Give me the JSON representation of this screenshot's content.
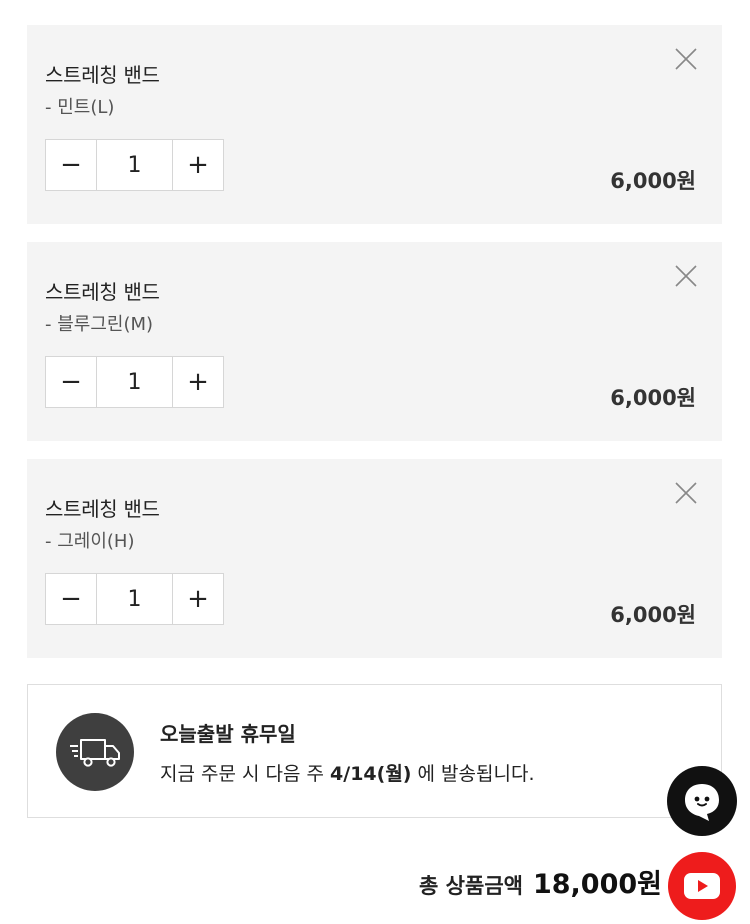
{
  "cart_items": [
    {
      "title": "스트레칭 밴드",
      "option": "- 민트(L)",
      "quantity": "1",
      "price": "6,000원"
    },
    {
      "title": "스트레칭 밴드",
      "option": "- 블루그린(M)",
      "quantity": "1",
      "price": "6,000원"
    },
    {
      "title": "스트레칭 밴드",
      "option": "- 그레이(H)",
      "quantity": "1",
      "price": "6,000원"
    }
  ],
  "stepper": {
    "minus": "−",
    "plus": "+"
  },
  "shipping_notice": {
    "title": "오늘출발 휴무일",
    "text_prefix": "지금 주문 시 다음 주 ",
    "date": "4/14(월)",
    "text_suffix": " 에 발송됩니다.",
    "icon": "truck-icon"
  },
  "total": {
    "label": "총 상품금액",
    "value": "18,000원"
  },
  "floating_buttons": {
    "chat_icon": "chat-bot-icon",
    "video_icon": "play-icon"
  },
  "colors": {
    "card_bg": "#f4f4f4",
    "youtube_red": "#ee1c1c",
    "icon_dark": "#3f3f3f"
  }
}
